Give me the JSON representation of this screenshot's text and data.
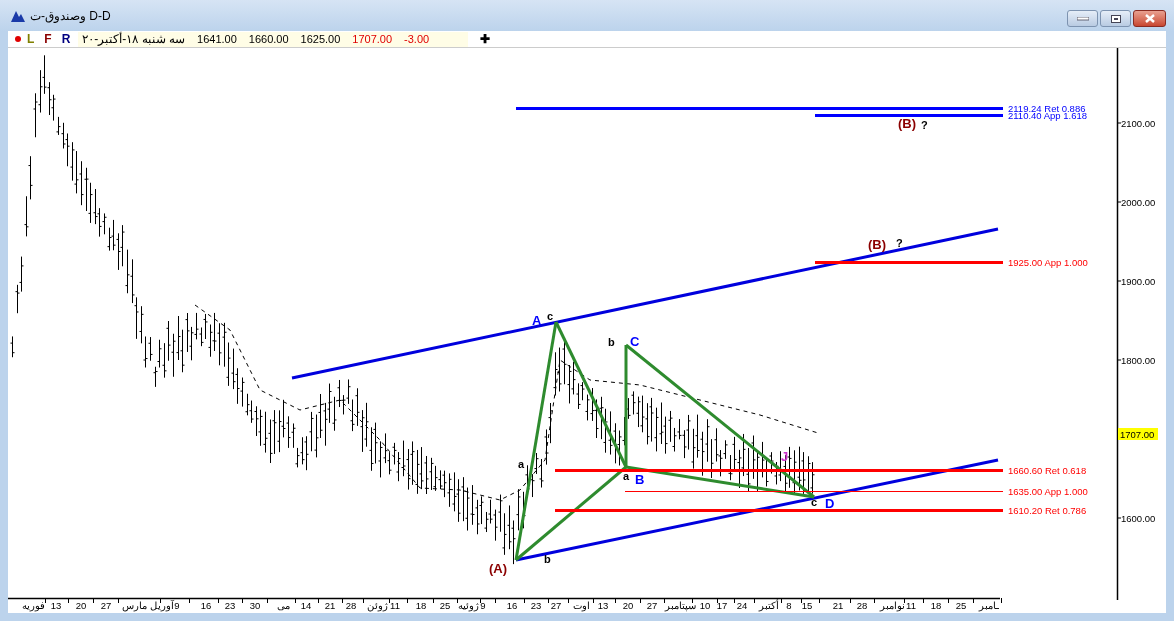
{
  "window": {
    "title": "وصندوق-ت D-D",
    "buttons": [
      {
        "kind": "minimize"
      },
      {
        "kind": "restore"
      },
      {
        "kind": "close"
      }
    ]
  },
  "toolbar": {
    "marks": [
      {
        "label": "R",
        "color": "#000080"
      },
      {
        "label": "F",
        "color": "#8b0000"
      },
      {
        "label": "L",
        "color": "#808000"
      }
    ],
    "date": "سه شنبه ۱۸-أکتبر-۲۰",
    "open": "1641.00",
    "high": "1660.00",
    "low": "1625.00",
    "close": "1707.00",
    "change": "-3.00",
    "add": "✚"
  },
  "chart": {
    "y_ticks": [
      "2100.00",
      "2000.00",
      "1900.00",
      "1800.00",
      "1600.00"
    ],
    "last_price": "1707.00",
    "x_labels": [
      "ـامبر",
      "25",
      "18",
      "11",
      "نوامبر",
      "28",
      "21",
      "15",
      "8",
      "أکتبر",
      "24",
      "17",
      "10",
      "سپتامبر",
      "27",
      "20",
      "13",
      "اوت",
      "27",
      "23",
      "16",
      "9",
      "ژوئیه",
      "25",
      "18",
      "11",
      "ژوئن",
      "28",
      "21",
      "14",
      "می",
      "30",
      "23",
      "16",
      "9",
      "آوریل مارس",
      "27",
      "20",
      "13",
      "فوریه"
    ],
    "levels": [
      {
        "label": "2119.24 Ret 0.886",
        "color": "#0000ff"
      },
      {
        "label": "2110.40 App 1.618",
        "color": "#0000ff"
      },
      {
        "label": "1925.00 App 1.000",
        "color": "#ff0000"
      },
      {
        "label": "1660.60 Ret 0.618",
        "color": "#ff0000"
      },
      {
        "label": "1635.00 App 1.000",
        "color": "#ff0000"
      },
      {
        "label": "1610.20 Ret 0.786",
        "color": "#ff0000"
      }
    ],
    "wave_labels": [
      {
        "text": "(B)",
        "color": "#8b0000"
      },
      {
        "text": "?",
        "color": "#000000"
      },
      {
        "text": "(B)",
        "color": "#8b0000"
      },
      {
        "text": "?",
        "color": "#000000"
      },
      {
        "text": "A",
        "color": "#0000ff"
      },
      {
        "text": "c",
        "color": "#000000"
      },
      {
        "text": "b",
        "color": "#000000"
      },
      {
        "text": "C",
        "color": "#0000ff"
      },
      {
        "text": "a",
        "color": "#000000"
      },
      {
        "text": "J",
        "color": "#cc33cc"
      },
      {
        "text": "a",
        "color": "#000000"
      },
      {
        "text": "B",
        "color": "#0000ff"
      },
      {
        "text": "c",
        "color": "#000000"
      },
      {
        "text": "D",
        "color": "#0000ff"
      },
      {
        "text": "b",
        "color": "#000000"
      },
      {
        "text": "(A)",
        "color": "#8b0000"
      }
    ]
  }
}
